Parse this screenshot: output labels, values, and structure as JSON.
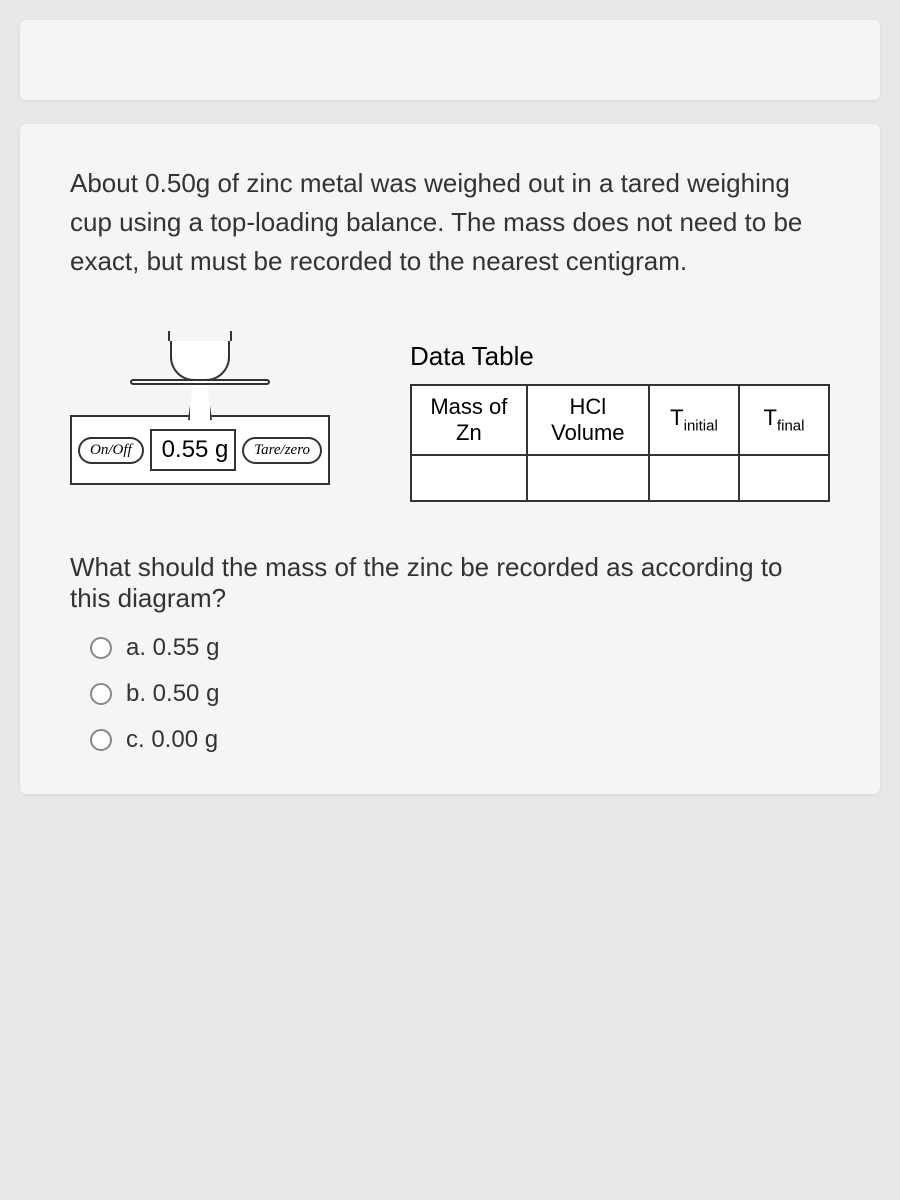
{
  "intro": "About 0.50g of zinc metal was weighed out in a tared weighing cup using a top-loading balance. The mass does not need to be exact, but must be recorded to the nearest centigram.",
  "balance": {
    "on_off": "On/Off",
    "display": "0.55 g",
    "tare": "Tare/zero"
  },
  "data_table": {
    "title": "Data Table",
    "headers": [
      "Mass of Zn",
      "HCl Volume",
      {
        "main": "T",
        "sub": "initial"
      },
      {
        "main": "T",
        "sub": "final"
      }
    ]
  },
  "question": "What should the mass of the zinc be recorded as according to this diagram?",
  "options": [
    {
      "label": "a. 0.55 g"
    },
    {
      "label": "b. 0.50 g"
    },
    {
      "label": "c. 0.00 g"
    }
  ]
}
